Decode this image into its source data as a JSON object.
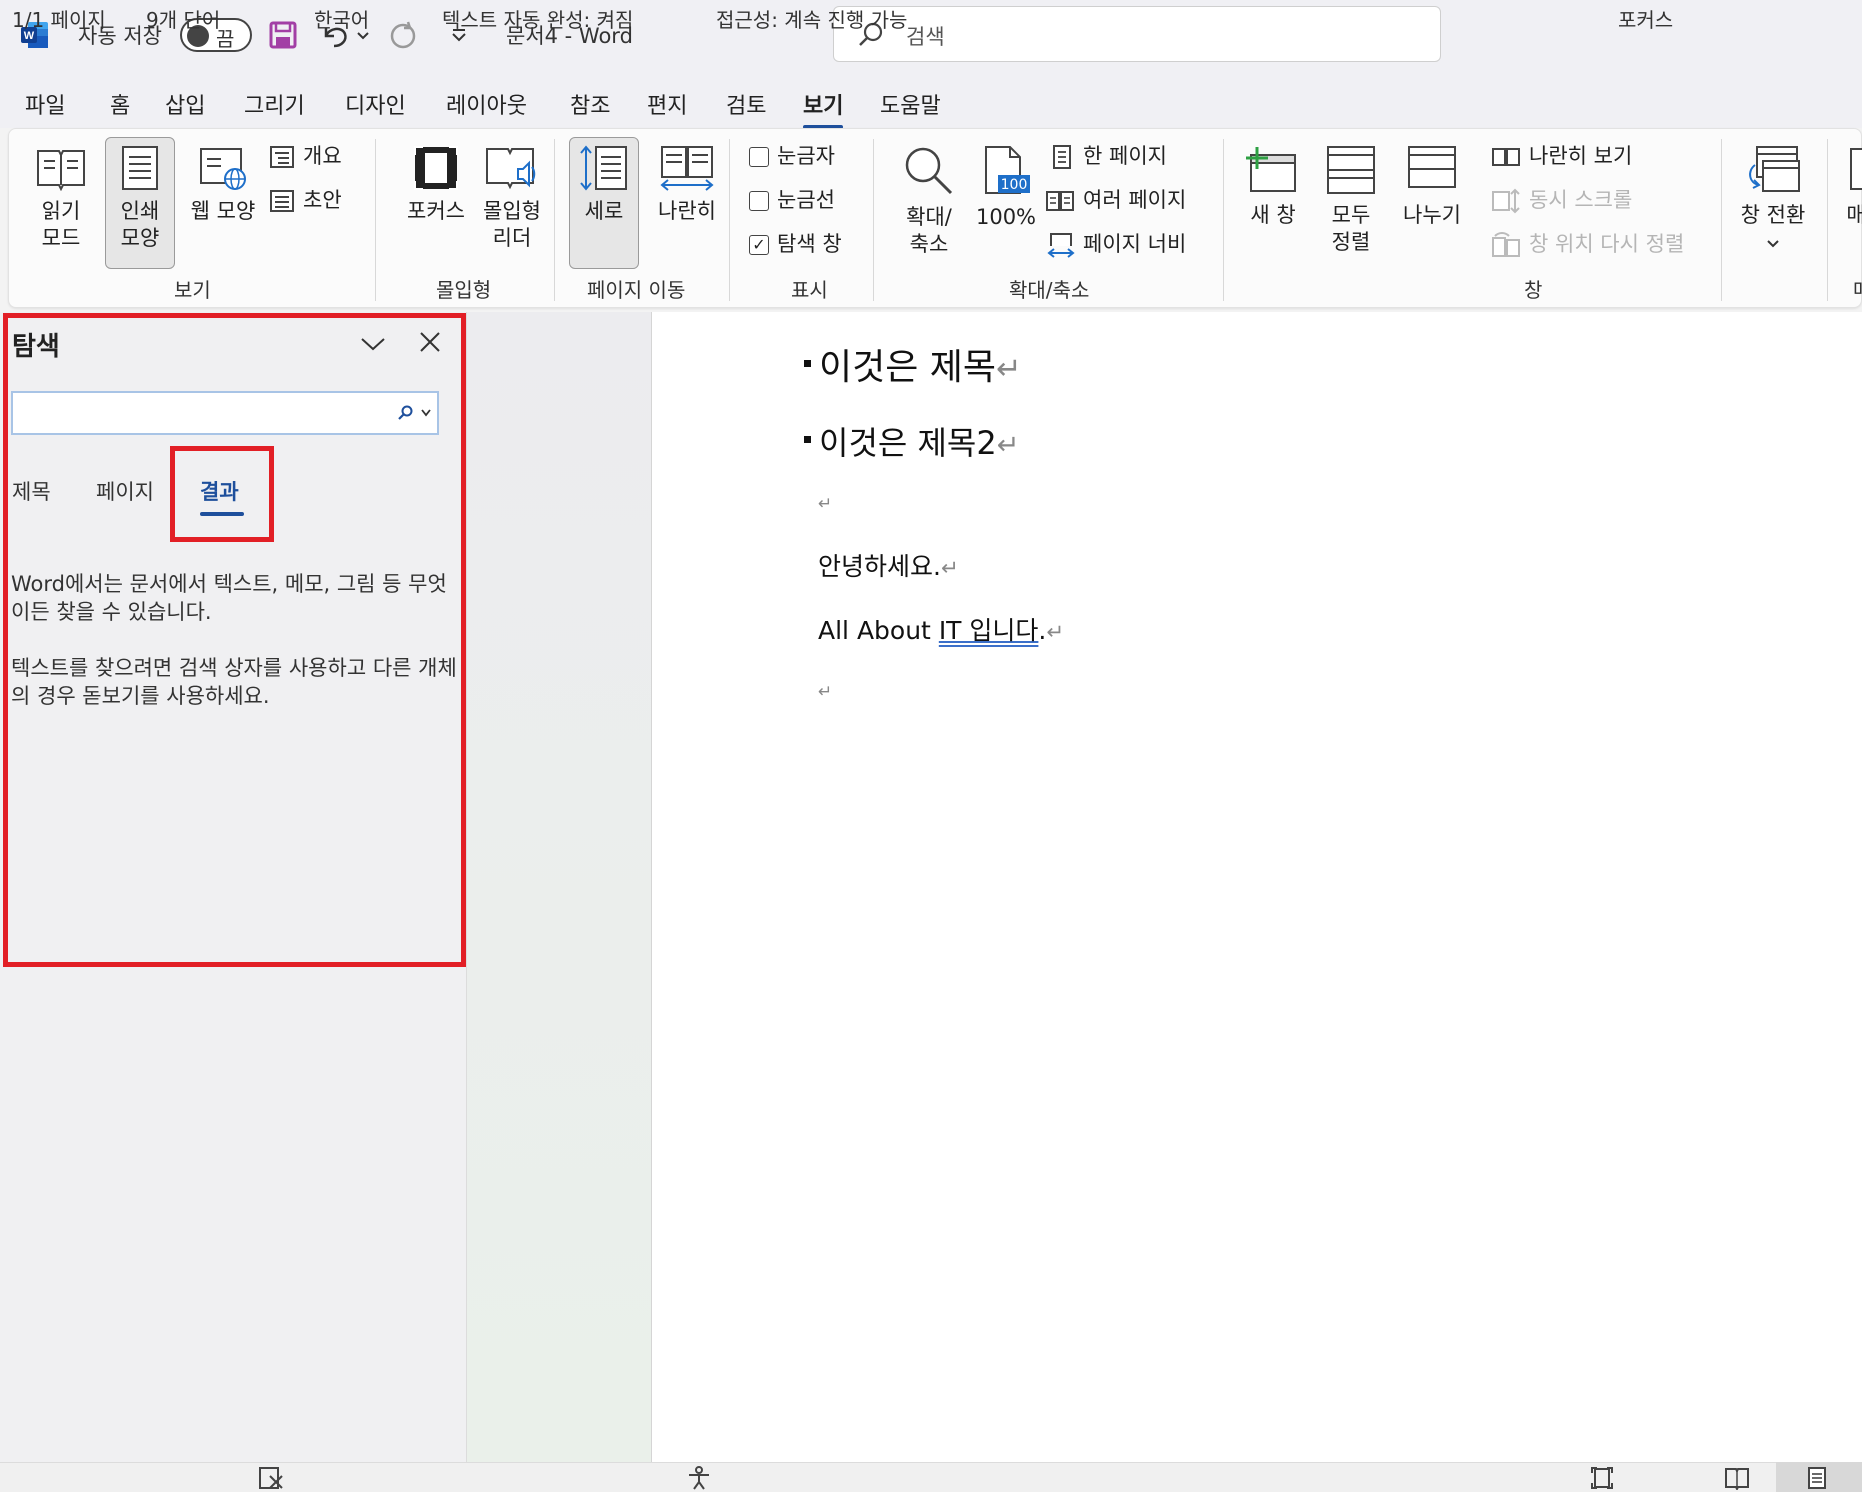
{
  "titlebar": {
    "autosave_label": "자동 저장",
    "autosave_state": "끔",
    "document_title": "문서4  -  Word",
    "search_placeholder": "검색"
  },
  "menu": {
    "tabs": [
      "파일",
      "홈",
      "삽입",
      "그리기",
      "디자인",
      "레이아웃",
      "참조",
      "편지",
      "검토",
      "보기",
      "도움말"
    ],
    "active": "보기"
  },
  "ribbon": {
    "view": {
      "read_mode": [
        "읽기",
        "모드"
      ],
      "print_layout": [
        "인쇄",
        "모양"
      ],
      "web_layout": "웹 모양",
      "outline": "개요",
      "draft": "초안",
      "group": "보기"
    },
    "immersive": {
      "focus": "포커스",
      "reader": [
        "몰입형",
        "리더"
      ],
      "group": "몰입형"
    },
    "page_movement": {
      "vertical": "세로",
      "side_to_side": "나란히",
      "group": "페이지 이동"
    },
    "show": {
      "ruler": "눈금자",
      "gridlines": "눈금선",
      "nav_pane": "탐색 창",
      "ruler_checked": false,
      "gridlines_checked": false,
      "nav_pane_checked": true,
      "group": "표시"
    },
    "zoom": {
      "zoom": [
        "확대/",
        "축소"
      ],
      "hundred": "100%",
      "hundred_icon": "100",
      "one_page": "한 페이지",
      "multiple_pages": "여러 페이지",
      "page_width": "페이지 너비",
      "group": "확대/축소"
    },
    "window": {
      "new_window": "새 창",
      "arrange_all": [
        "모두",
        "정렬"
      ],
      "split": "나누기",
      "side_by_side": "나란히 보기",
      "sync_scroll": "동시 스크롤",
      "reset_position": "창 위치 다시 정렬",
      "switch_windows": "창 전환",
      "group": "창"
    },
    "macros_partial": "매"
  },
  "nav_pane": {
    "title": "탐색",
    "search_value": "",
    "tabs": [
      "제목",
      "페이지",
      "결과"
    ],
    "active_tab": "결과",
    "paragraph1": "Word에서는 문서에서 텍스트, 메모, 그림 등 무엇이든 찾을 수 있습니다.",
    "paragraph2": "텍스트를 찾으려면 검색 상자를 사용하고 다른 개체의 경우 돋보기를 사용하세요."
  },
  "document": {
    "heading1": "이것은  제목",
    "heading2": "이것은  제목2",
    "line_greeting": "안녕하세요.",
    "line_all_about_prefix": "All About ",
    "line_all_about_underlined": "IT  입니다",
    "line_all_about_suffix": ".",
    "pilcrow": "↵"
  },
  "statusbar": {
    "page": "1/1 페이지",
    "words": "9개 단어",
    "language": "한국어",
    "autocomplete": "텍스트 자동 완성: 켜짐",
    "accessibility": "접근성: 계속 진행 가능",
    "focus": "포커스"
  },
  "colors": {
    "accent": "#1e4f9c",
    "highlight_box": "#e21f26",
    "word_blue": "#185abd",
    "save_purple": "#a23fa5"
  }
}
